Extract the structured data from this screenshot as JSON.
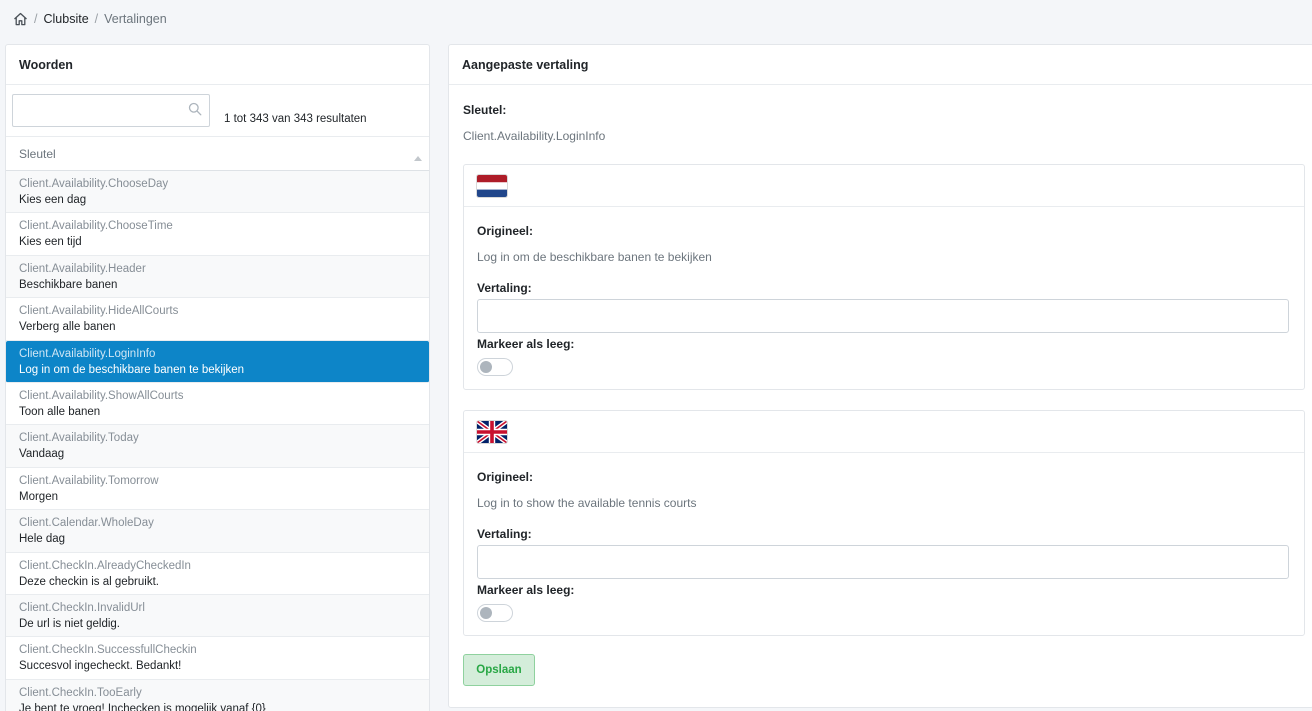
{
  "breadcrumb": {
    "items": [
      "Clubsite",
      "Vertalingen"
    ],
    "separator": "/"
  },
  "left": {
    "title": "Woorden",
    "search": {
      "value": "",
      "placeholder": ""
    },
    "result_count": "1 tot 343 van 343 resultaten",
    "column": "Sleutel",
    "rows": [
      {
        "key": "Client.Availability.ChooseDay",
        "value": "Kies een dag"
      },
      {
        "key": "Client.Availability.ChooseTime",
        "value": "Kies een tijd"
      },
      {
        "key": "Client.Availability.Header",
        "value": "Beschikbare banen"
      },
      {
        "key": "Client.Availability.HideAllCourts",
        "value": "Verberg alle banen"
      },
      {
        "key": "Client.Availability.LoginInfo",
        "value": "Log in om de beschikbare banen te bekijken"
      },
      {
        "key": "Client.Availability.ShowAllCourts",
        "value": "Toon alle banen"
      },
      {
        "key": "Client.Availability.Today",
        "value": "Vandaag"
      },
      {
        "key": "Client.Availability.Tomorrow",
        "value": "Morgen"
      },
      {
        "key": "Client.Calendar.WholeDay",
        "value": "Hele dag"
      },
      {
        "key": "Client.CheckIn.AlreadyCheckedIn",
        "value": "Deze checkin is al gebruikt."
      },
      {
        "key": "Client.CheckIn.InvalidUrl",
        "value": "De url is niet geldig."
      },
      {
        "key": "Client.CheckIn.SuccessfullCheckin",
        "value": "Succesvol ingecheckt. Bedankt!"
      },
      {
        "key": "Client.CheckIn.TooEarly",
        "value": "Je bent te vroeg! Inchecken is mogelijk vanaf {0}"
      }
    ],
    "active_index": 4
  },
  "right": {
    "title": "Aangepaste vertaling",
    "key_label": "Sleutel:",
    "key_value": "Client.Availability.LoginInfo",
    "languages": [
      {
        "flag": "netherlands-flag-icon",
        "original_label": "Origineel:",
        "original_value": "Log in om de beschikbare banen te bekijken",
        "translation_label": "Vertaling:",
        "translation_value": "",
        "empty_label": "Markeer als leeg:",
        "empty_checked": false
      },
      {
        "flag": "united-kingdom-flag-icon",
        "original_label": "Origineel:",
        "original_value": "Log in to show the available tennis courts",
        "translation_label": "Vertaling:",
        "translation_value": "",
        "empty_label": "Markeer als leeg:",
        "empty_checked": false
      }
    ],
    "save_label": "Opslaan"
  },
  "colors": {
    "active_row": "#0d85c8",
    "save_bg": "#d4edda",
    "save_text": "#28a745",
    "page_bg": "#f4f6f9"
  }
}
